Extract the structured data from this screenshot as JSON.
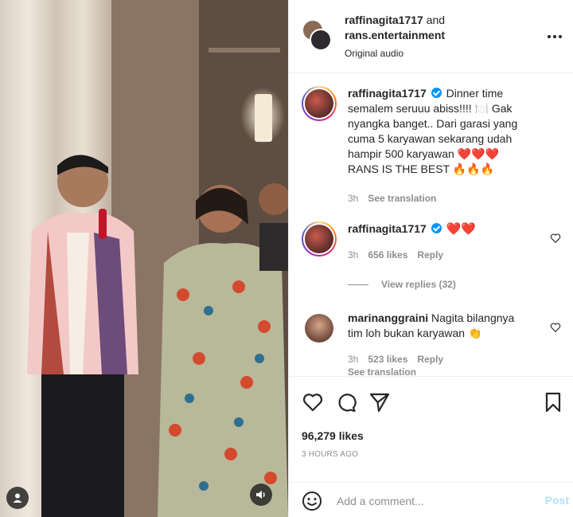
{
  "header": {
    "user1": "raffinagita1717",
    "and_word": "and",
    "user2": "rans.entertainment",
    "audio": "Original audio"
  },
  "caption": {
    "username": "raffinagita1717",
    "text": "Dinner time semalem seruuu abiss!!!! 🍽️ Gak nyangka banget.. Dari garasi yang cuma 5 karyawan sekarang udah hampir 500 karyawan ❤️❤️❤️ RANS IS THE BEST 🔥🔥🔥",
    "time": "3h",
    "see_translation": "See translation"
  },
  "comments": [
    {
      "username": "raffinagita1717",
      "text": "❤️❤️",
      "time": "3h",
      "likes": "656 likes",
      "reply": "Reply",
      "view_replies": "View replies (32)"
    },
    {
      "username": "marinanggraini",
      "text": "Nagita bilangnya tim loh bukan karyawan 👏",
      "time": "3h",
      "likes": "523 likes",
      "reply": "Reply",
      "see_translation": "See translation"
    }
  ],
  "actions": {
    "likes": "96,279 likes",
    "timestamp": "3 HOURS AGO",
    "comment_placeholder": "Add a comment...",
    "post_label": "Post"
  },
  "colors": {
    "accent": "#0095f6",
    "heart": "#ed4956",
    "muted": "#8e8e8e",
    "post_disabled": "#b2dffc"
  }
}
